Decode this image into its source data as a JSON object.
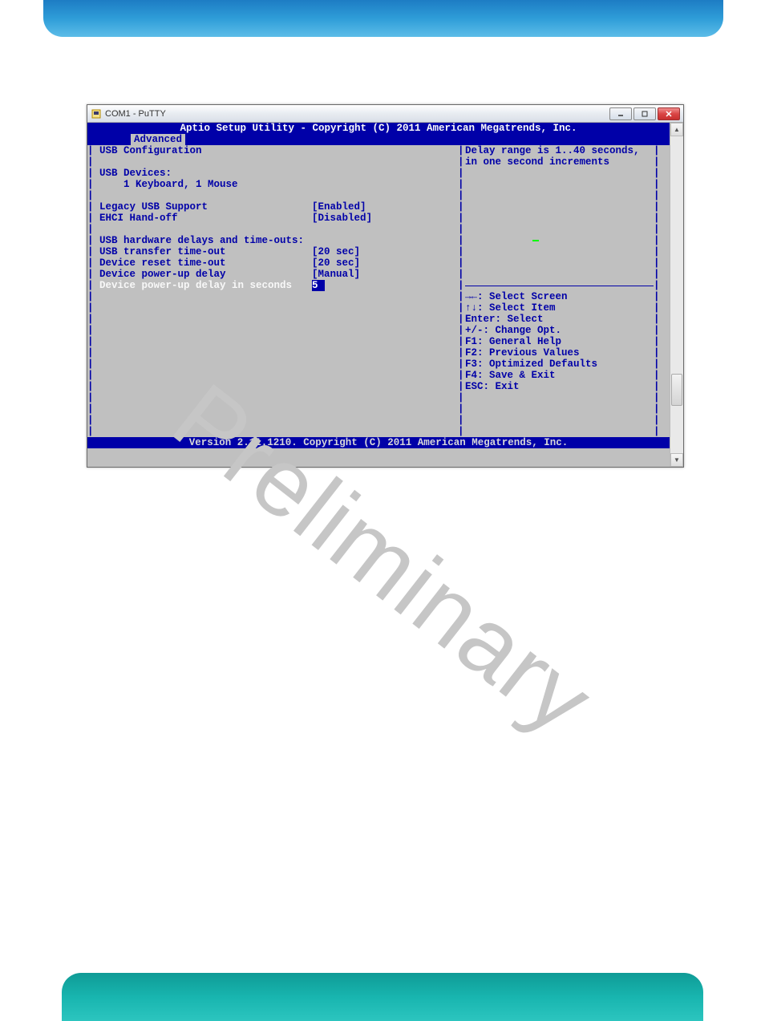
{
  "window": {
    "title": "COM1 - PuTTY"
  },
  "bios": {
    "header": "Aptio Setup Utility - Copyright (C) 2011 American Megatrends, Inc.",
    "tab": " Advanced ",
    "footer": "Version 2.11.1210. Copyright (C) 2011 American Megatrends, Inc.",
    "section_title": "USB Configuration",
    "devices_label": "USB Devices:",
    "devices_value": "1 Keyboard, 1 Mouse",
    "rows": [
      {
        "label": "Legacy USB Support",
        "value": "[Enabled]"
      },
      {
        "label": "EHCI Hand-off",
        "value": "[Disabled]"
      }
    ],
    "subsection": "USB hardware delays and time-outs:",
    "rows2": [
      {
        "label": "USB transfer time-out",
        "value": "[20 sec]"
      },
      {
        "label": "Device reset time-out",
        "value": "[20 sec]"
      },
      {
        "label": "Device power-up delay",
        "value": "[Manual]"
      }
    ],
    "selected": {
      "label": "Device power-up delay in seconds",
      "value": "5"
    },
    "help_line1": "Delay range is 1..40 seconds,",
    "help_line2": "in one second increments",
    "nav": [
      "→←: Select Screen",
      "↑↓: Select Item",
      "Enter: Select",
      "+/-: Change Opt.",
      "F1: General Help",
      "F2: Previous Values",
      "F3: Optimized Defaults",
      "F4: Save & Exit",
      "ESC: Exit"
    ]
  },
  "watermark": "Preliminary"
}
